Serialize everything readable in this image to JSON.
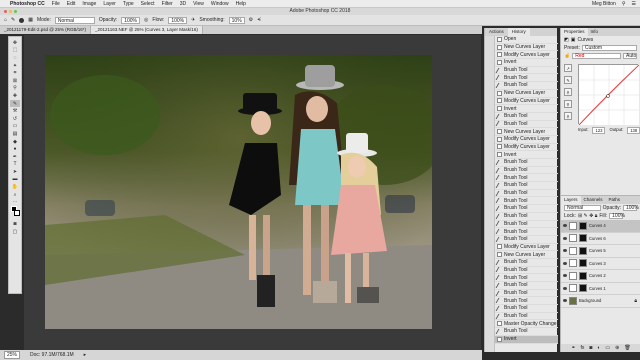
{
  "menubar": {
    "app": "Photoshop CC",
    "items": [
      "File",
      "Edit",
      "Image",
      "Layer",
      "Type",
      "Select",
      "Filter",
      "3D",
      "View",
      "Window",
      "Help"
    ],
    "user": "Meg Bitton"
  },
  "window": {
    "title": "Adobe Photoshop CC 2018"
  },
  "options": {
    "mode_label": "Mode:",
    "mode_value": "Normal",
    "opacity_label": "Opacity:",
    "opacity_value": "100%",
    "flow_label": "Flow:",
    "flow_value": "100%",
    "smoothing_label": "Smoothing:",
    "smoothing_value": "10%"
  },
  "tabs": [
    {
      "label": "_20121179-Edit-2.psd @ 25% (RGB/16*)"
    },
    {
      "label": "_20121163.NEF @ 25% (Curves 3, Layer Mask/16)"
    }
  ],
  "status": {
    "zoom": "25%",
    "doc": "Doc: 97.1M/768.1M"
  },
  "history": {
    "tabs": [
      "Actions",
      "History"
    ],
    "items": [
      "Open",
      "New Curves Layer",
      "Modify Curves Layer",
      "Invert",
      "Brush Tool",
      "Brush Tool",
      "Brush Tool",
      "New Curves Layer",
      "Modify Curves Layer",
      "Invert",
      "Brush Tool",
      "Brush Tool",
      "New Curves Layer",
      "Modify Curves Layer",
      "Modify Curves Layer",
      "Invert",
      "Brush Tool",
      "Brush Tool",
      "Brush Tool",
      "Brush Tool",
      "Brush Tool",
      "Brush Tool",
      "Brush Tool",
      "Brush Tool",
      "Brush Tool",
      "Brush Tool",
      "Brush Tool",
      "Modify Curves Layer",
      "New Curves Layer",
      "Brush Tool",
      "Brush Tool",
      "Brush Tool",
      "Brush Tool",
      "Brush Tool",
      "Brush Tool",
      "Brush Tool",
      "Brush Tool",
      "Master Opacity Change",
      "Brush Tool",
      "Invert"
    ],
    "selected_index": 39
  },
  "properties": {
    "tabs": [
      "Properties",
      "Info"
    ],
    "title": "Curves",
    "preset_label": "Preset:",
    "preset_value": "Custom",
    "channel_value": "Red",
    "auto_label": "Auto",
    "input_label": "Input:",
    "input_value": "123",
    "output_label": "Output:",
    "output_value": "138"
  },
  "layers": {
    "tabs": [
      "Layers",
      "Channels",
      "Paths"
    ],
    "blend": "Normal",
    "opacity_label": "Opacity:",
    "opacity_value": "100%",
    "lock_label": "Lock:",
    "fill_label": "Fill:",
    "fill_value": "100%",
    "items": [
      {
        "name": "Curves 4",
        "selected": true
      },
      {
        "name": "Curves 6",
        "selected": false
      },
      {
        "name": "Curves 5",
        "selected": false
      },
      {
        "name": "Curves 3",
        "selected": false
      },
      {
        "name": "Curves 2",
        "selected": false
      },
      {
        "name": "Curves 1",
        "selected": false
      },
      {
        "name": "Background",
        "selected": false
      }
    ]
  },
  "colors": {
    "accent": "#e04040"
  }
}
